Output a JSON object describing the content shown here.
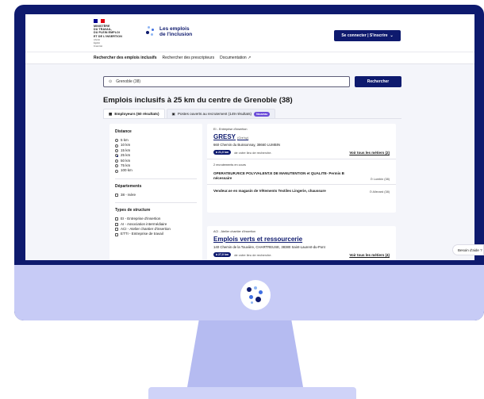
{
  "header": {
    "ministry_lines": [
      "MINISTÈRE",
      "DU TRAVAIL,",
      "DU PLEIN EMPLOI",
      "ET DE L'INSERTION"
    ],
    "motto": [
      "Liberté",
      "Égalité",
      "Fraternité"
    ],
    "brand_line1": "Les emplois",
    "brand_line2": "de l'inclusion",
    "login_label": "Se connecter | S'inscrire",
    "login_chevron": "⌄"
  },
  "nav": {
    "items": [
      "Rechercher des emplois inclusifs",
      "Rechercher des prescripteurs",
      "Documentation ↗"
    ]
  },
  "search": {
    "value": "Grenoble (38)",
    "button_label": "Rechercher"
  },
  "page_title": "Emplois inclusifs à 25 km du centre de Grenoble (38)",
  "tabs": {
    "employers": "Employeurs (60 résultats)",
    "positions": "Postes ouverts au recrutement (149 résultats)",
    "new_badge": "Nouveau"
  },
  "filters": {
    "distance_title": "Distance",
    "distances": [
      "5 km",
      "10 km",
      "15 km",
      "25 km",
      "50 km",
      "75 km",
      "100 km"
    ],
    "selected_distance": "25 km",
    "departments_title": "Départements",
    "departments": [
      "38 - Isère"
    ],
    "structure_title": "Types de structure",
    "structures": [
      "EI - Entreprise d'insertion",
      "AI - Association intermédiaire",
      "ACI - Atelier chantier d'insertion",
      "ETTI - Entreprise de travail"
    ]
  },
  "cards": [
    {
      "type": "EI - Entreprise d'insertion",
      "name": "GRESY",
      "city_hint": "(Gre'sy)",
      "address": "660 Chemin du Buissonnay, 38660 LUMBIN",
      "distance": "à 21,0 km",
      "distance_suffix": "de votre lieu de recherche.",
      "link": "Voir tous les métiers (2)",
      "recruit_count": "2 recrutements en cours",
      "jobs": [
        {
          "title": "OPERATEUR.RICE POLYVALENT.E DE MANUTENTION et QUALITE- Permis B nécessaire",
          "location": "Lumbin (38)"
        },
        {
          "title": "Vendeur.se en magasin de Vêtements Textiles Lingerie, chaussure",
          "location": "Allevard (38)"
        }
      ]
    },
    {
      "type": "ACI - Atelier chantier d'insertion",
      "name": "Emplois verts et ressourcerie",
      "address": "140 Chemin de la Touvière, CHARTREUSE, 38380 Saint-Laurent-du-Pont",
      "distance": "à 27,0 km",
      "distance_suffix": "de votre lieu de recherche.",
      "link": "Voir tous les métiers (4)"
    }
  ],
  "help_button": "Besoin d'aide ?",
  "colors": {
    "bezel": "#0e1a6e",
    "primary": "#0e1a6e",
    "lavender": "#c7cbf6",
    "new_badge": "#6a4bd8"
  }
}
